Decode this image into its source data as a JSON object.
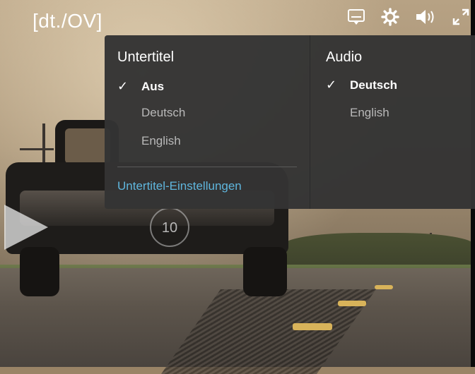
{
  "player": {
    "title_tag": "[dt./OV]",
    "controls": {
      "subtitles_icon": "subtitles-icon",
      "settings_icon": "gear-icon",
      "volume_icon": "volume-icon",
      "fullscreen_icon": "fullscreen-icon"
    },
    "skip_forward_seconds": "10"
  },
  "menu": {
    "subtitles": {
      "heading": "Untertitel",
      "options": [
        {
          "label": "Aus",
          "selected": true
        },
        {
          "label": "Deutsch",
          "selected": false
        },
        {
          "label": "English",
          "selected": false
        }
      ],
      "settings_link": "Untertitel-Einstellungen"
    },
    "audio": {
      "heading": "Audio",
      "options": [
        {
          "label": "Deutsch",
          "selected": true
        },
        {
          "label": "English",
          "selected": false
        }
      ]
    },
    "check_glyph": "✓"
  },
  "colors": {
    "menu_bg": "#343434",
    "link": "#5fb6dd",
    "selected_text": "#ffffff",
    "unselected_text": "#b9b9b9"
  }
}
